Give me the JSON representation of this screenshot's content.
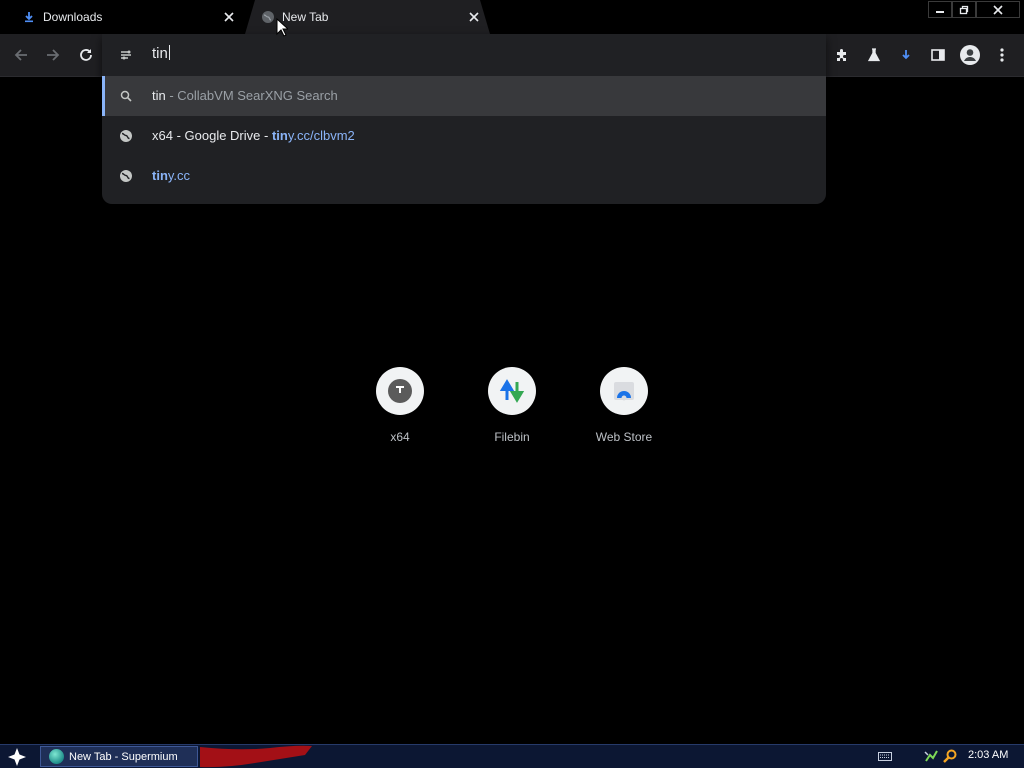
{
  "tabs": [
    {
      "title": "Downloads",
      "icon": "download-icon",
      "active": false
    },
    {
      "title": "New Tab",
      "icon": "globe-icon",
      "active": true
    }
  ],
  "window_controls": {
    "minimize": "minimize-icon",
    "restore": "restore-icon",
    "close": "close-icon"
  },
  "toolbar": {
    "left_icons": [
      "back-arrow-icon",
      "forward-arrow-icon",
      "reload-icon"
    ],
    "right_icons": [
      "extensions-icon",
      "labs-icon",
      "download-icon",
      "side-panel-icon",
      "profile-icon",
      "menu-icon"
    ]
  },
  "omnibox": {
    "typed_text": "tin",
    "suggestions": [
      {
        "icon": "search-icon",
        "match": "tin",
        "rest": " - CollabVM SearXNG Search"
      },
      {
        "icon": "globe-icon",
        "title": "x64 - Google Drive - ",
        "url_match": "tin",
        "url_rest": "y.cc/clbvm2"
      },
      {
        "icon": "globe-icon",
        "url_match": "tin",
        "url_rest": "y.cc"
      }
    ]
  },
  "shortcuts": [
    {
      "label": "x64",
      "icon": "x64-logo-icon"
    },
    {
      "label": "Filebin",
      "icon": "filebin-arrows-icon"
    },
    {
      "label": "Web Store",
      "icon": "web-store-icon"
    }
  ],
  "taskbar": {
    "task_label": "New Tab - Supermium",
    "clock": "2:03 AM"
  },
  "colors": {
    "accent": "#8ab4f8",
    "toolbar_bg": "#1f1f22",
    "taskbar_bg": "#0c1733"
  }
}
